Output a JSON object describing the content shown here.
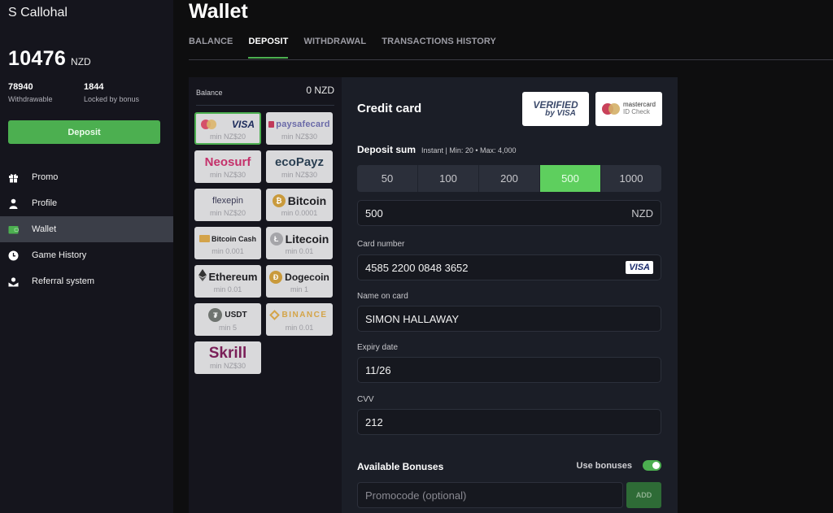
{
  "sidebar": {
    "username": "S Callohal",
    "balance": {
      "amount": "10476",
      "currency": "NZD"
    },
    "withdrawable": {
      "value": "78940",
      "label": "Withdrawable"
    },
    "locked": {
      "value": "1844",
      "label": "Locked by bonus"
    },
    "deposit_label": "Deposit",
    "nav": [
      {
        "label": "Promo",
        "icon": "gift-icon"
      },
      {
        "label": "Profile",
        "icon": "user-icon"
      },
      {
        "label": "Wallet",
        "icon": "wallet-icon",
        "active": true
      },
      {
        "label": "Game History",
        "icon": "clock-icon"
      },
      {
        "label": "Referral system",
        "icon": "referral-icon"
      }
    ]
  },
  "header": {
    "title": "Wallet",
    "tabs": [
      {
        "label": "BALANCE"
      },
      {
        "label": "DEPOSIT",
        "active": true
      },
      {
        "label": "WITHDRAWAL"
      },
      {
        "label": "TRANSACTIONS HISTORY"
      }
    ]
  },
  "methods": {
    "balance_label": "Balance",
    "balance_value": "0 NZD",
    "items": [
      {
        "name": "Mastercard / VISA",
        "logo": "VISA",
        "min": "min NZ$20",
        "selected": true
      },
      {
        "name": "paysafecard",
        "logo": "paysafecard",
        "min": "min NZ$30"
      },
      {
        "name": "Neosurf",
        "logo": "Neosurf",
        "min": "min NZ$30"
      },
      {
        "name": "ecoPayz",
        "logo": "ecoPayz",
        "min": "min NZ$30"
      },
      {
        "name": "flexepin",
        "logo": "flexepin",
        "min": "min NZ$20"
      },
      {
        "name": "Bitcoin",
        "logo": "Bitcoin",
        "min": "min 0.0001"
      },
      {
        "name": "Bitcoin Cash",
        "logo": "Bitcoin Cash",
        "min": "min 0.001"
      },
      {
        "name": "Litecoin",
        "logo": "Litecoin",
        "min": "min 0.01"
      },
      {
        "name": "Ethereum",
        "logo": "Ethereum",
        "min": "min 0.01"
      },
      {
        "name": "Dogecoin",
        "logo": "Dogecoin",
        "min": "min 1"
      },
      {
        "name": "USDT",
        "logo": "USDT",
        "min": "min 5"
      },
      {
        "name": "Binance",
        "logo": "BINANCE",
        "min": "min 0.01"
      },
      {
        "name": "Skrill",
        "logo": "Skrill",
        "min": "min NZ$30"
      }
    ]
  },
  "form": {
    "title": "Credit card",
    "badges": {
      "verified_line1": "VERIFIED",
      "verified_line2": "by VISA",
      "mc_line1": "mastercard",
      "mc_line2": "ID Check"
    },
    "deposit_sum_label": "Deposit sum",
    "deposit_sum_info": "Instant | Min: 20 • Max: 4,000",
    "presets": [
      "50",
      "100",
      "200",
      "500",
      "1000"
    ],
    "selected_preset": "500",
    "amount": {
      "value": "500",
      "currency": "NZD"
    },
    "card_number": {
      "label": "Card number",
      "value": "4585 2200 0848 3652",
      "brand": "VISA"
    },
    "name_on_card": {
      "label": "Name on card",
      "value": "SIMON HALLAWAY"
    },
    "expiry": {
      "label": "Expiry date",
      "value": "11/26"
    },
    "cvv": {
      "label": "CVV",
      "value": "212"
    },
    "bonuses": {
      "title": "Available Bonuses",
      "use_label": "Use bonuses",
      "use_enabled": true,
      "promo_placeholder": "Promocode (optional)",
      "add_label": "ADD"
    }
  },
  "colors": {
    "accent": "#4caf50",
    "preset_active": "#5ecf5e",
    "sidebar_bg": "#15151d",
    "panel_bg": "#1b1e27"
  }
}
